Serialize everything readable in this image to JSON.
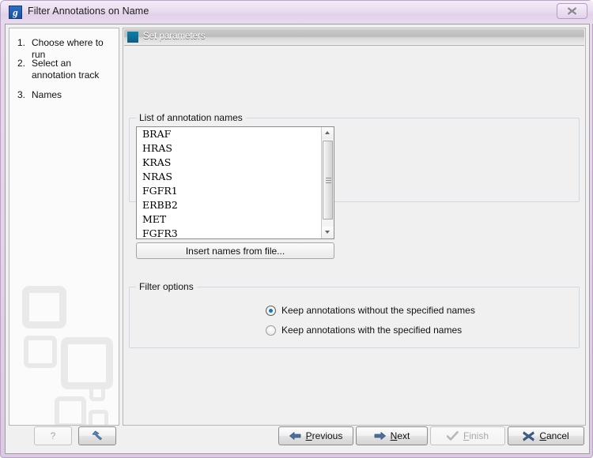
{
  "window": {
    "title": "Filter Annotations on Name",
    "app_icon": "g",
    "close_icon": "close-icon"
  },
  "sidebar": {
    "steps": [
      {
        "num": "1.",
        "label": "Choose where to run"
      },
      {
        "num": "2.",
        "label": "Select an annotation track"
      },
      {
        "num": "3.",
        "label": "Names"
      }
    ]
  },
  "content": {
    "header": {
      "title": "Set parameters"
    },
    "names_group": {
      "title": "List of annotation names",
      "items": [
        "BRAF",
        "HRAS",
        "KRAS",
        "NRAS",
        "FGFR1",
        "ERBB2",
        "MET",
        "FGFR3"
      ],
      "insert_button": "Insert names from file..."
    },
    "filter_group": {
      "title": "Filter options",
      "options": [
        {
          "label": "Keep annotations without the specified names",
          "selected": true
        },
        {
          "label": "Keep annotations with the specified names",
          "selected": false
        }
      ]
    }
  },
  "footer": {
    "help_label": "?",
    "reset_name": "reset-icon",
    "previous": {
      "pre": "P",
      "mnemonic": "",
      "rest": "revious",
      "label": "Previous"
    },
    "next": {
      "pre": "",
      "mnemonic": "N",
      "rest": "ext",
      "label": "Next"
    },
    "finish": {
      "pre": "",
      "mnemonic": "F",
      "rest": "inish",
      "label": "Finish"
    },
    "cancel": {
      "pre": "",
      "mnemonic": "C",
      "rest": "ancel",
      "label": "Cancel"
    }
  },
  "colors": {
    "accent": "#1078b4",
    "header_swatch": "#0d7fa8",
    "frame": "#e4d3ea"
  }
}
